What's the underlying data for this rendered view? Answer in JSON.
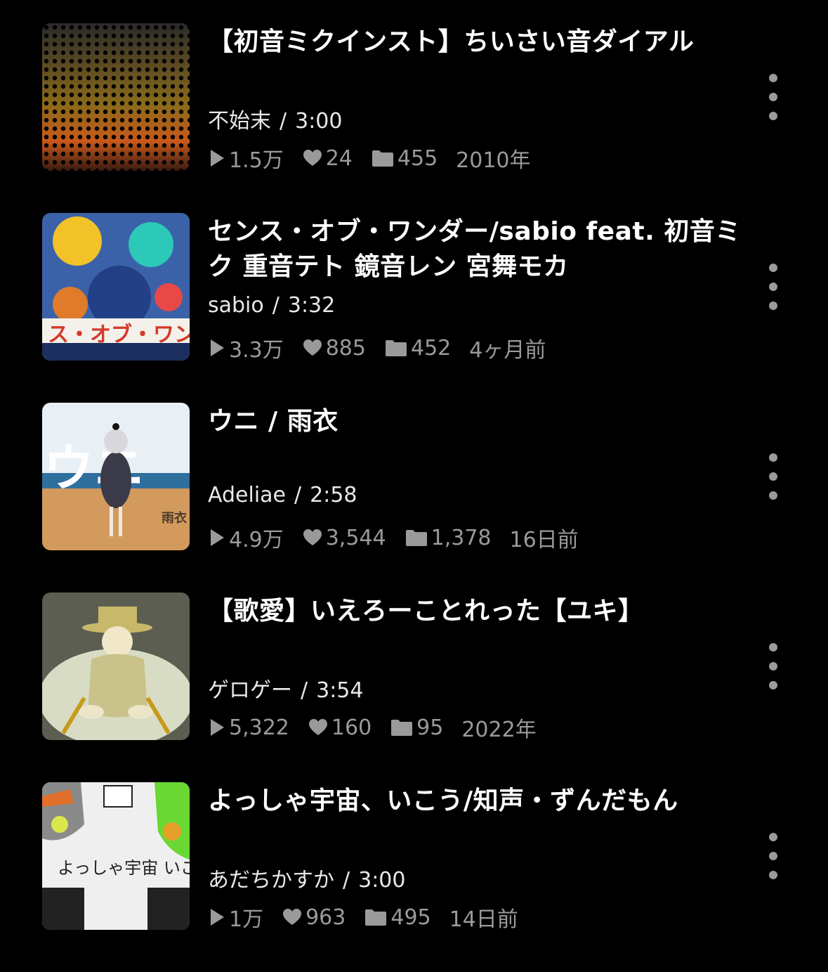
{
  "items": [
    {
      "title": "【初音ミクインスト】ちいさい音ダイアル",
      "author": "不始末",
      "duration": "3:00",
      "views": "1.5万",
      "likes": "24",
      "mylists": "455",
      "date": "2010年"
    },
    {
      "title": "センス・オブ・ワンダー/sabio feat. 初音ミク 重音テト 鏡音レン 宮舞モカ",
      "author": "sabio",
      "duration": "3:32",
      "views": "3.3万",
      "likes": "885",
      "mylists": "452",
      "date": "4ヶ月前",
      "thumb_text": "ス・オブ・ワン"
    },
    {
      "title": "ウニ / 雨衣",
      "author": "Adeliae",
      "duration": "2:58",
      "views": "4.9万",
      "likes": "3,544",
      "mylists": "1,378",
      "date": "16日前",
      "thumb_text": "ウニ",
      "thumb_subtext": "雨衣"
    },
    {
      "title": "【歌愛】いえろーことれった【ユキ】",
      "author": "ゲロゲー",
      "duration": "3:54",
      "views": "5,322",
      "likes": "160",
      "mylists": "95",
      "date": "2022年"
    },
    {
      "title": "よっしゃ宇宙、いこう/知声・ずんだもん",
      "author": "あだちかすか",
      "duration": "3:00",
      "views": "1万",
      "likes": "963",
      "mylists": "495",
      "date": "14日前",
      "thumb_text": "よっしゃ宇宙 いこう"
    }
  ],
  "separator": "/",
  "colors": {
    "background": "#000000",
    "title": "#ffffff",
    "meta": "#e8e8e8",
    "stats": "#9a9a9a",
    "more_dots": "#9b9b9b"
  },
  "icons": {
    "views": "play-icon",
    "likes": "heart-icon",
    "mylists": "folder-icon",
    "more": "more-vertical-icon"
  }
}
